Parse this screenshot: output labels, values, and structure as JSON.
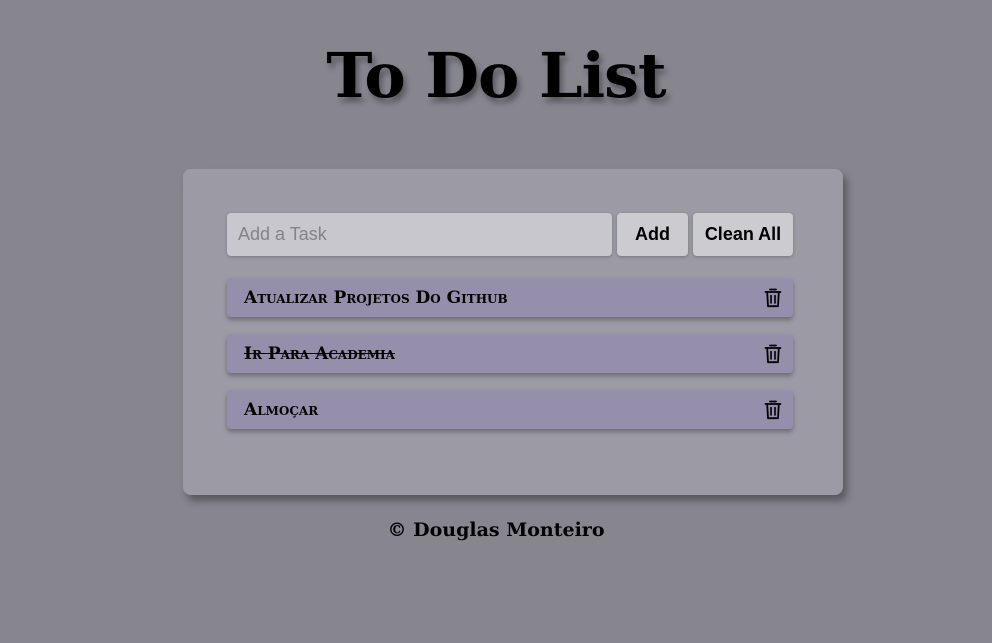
{
  "header": {
    "title": "To Do List"
  },
  "form": {
    "input_placeholder": "Add a Task",
    "input_value": "",
    "add_label": "Add",
    "clean_all_label": "Clean All"
  },
  "tasks": [
    {
      "text": "Atualizar Projetos Do Github",
      "completed": false,
      "icon": "trash-icon"
    },
    {
      "text": "Ir Para Academia",
      "completed": true,
      "icon": "trash-icon"
    },
    {
      "text": "Almoçar",
      "completed": false,
      "icon": "trash-icon"
    }
  ],
  "footer": {
    "text": "© Douglas Monteiro"
  },
  "colors": {
    "background": "#87868f",
    "card": "#9c9ba5",
    "task_item": "#958fab",
    "input": "#c8c7cd",
    "button": "#cbcbd0"
  }
}
